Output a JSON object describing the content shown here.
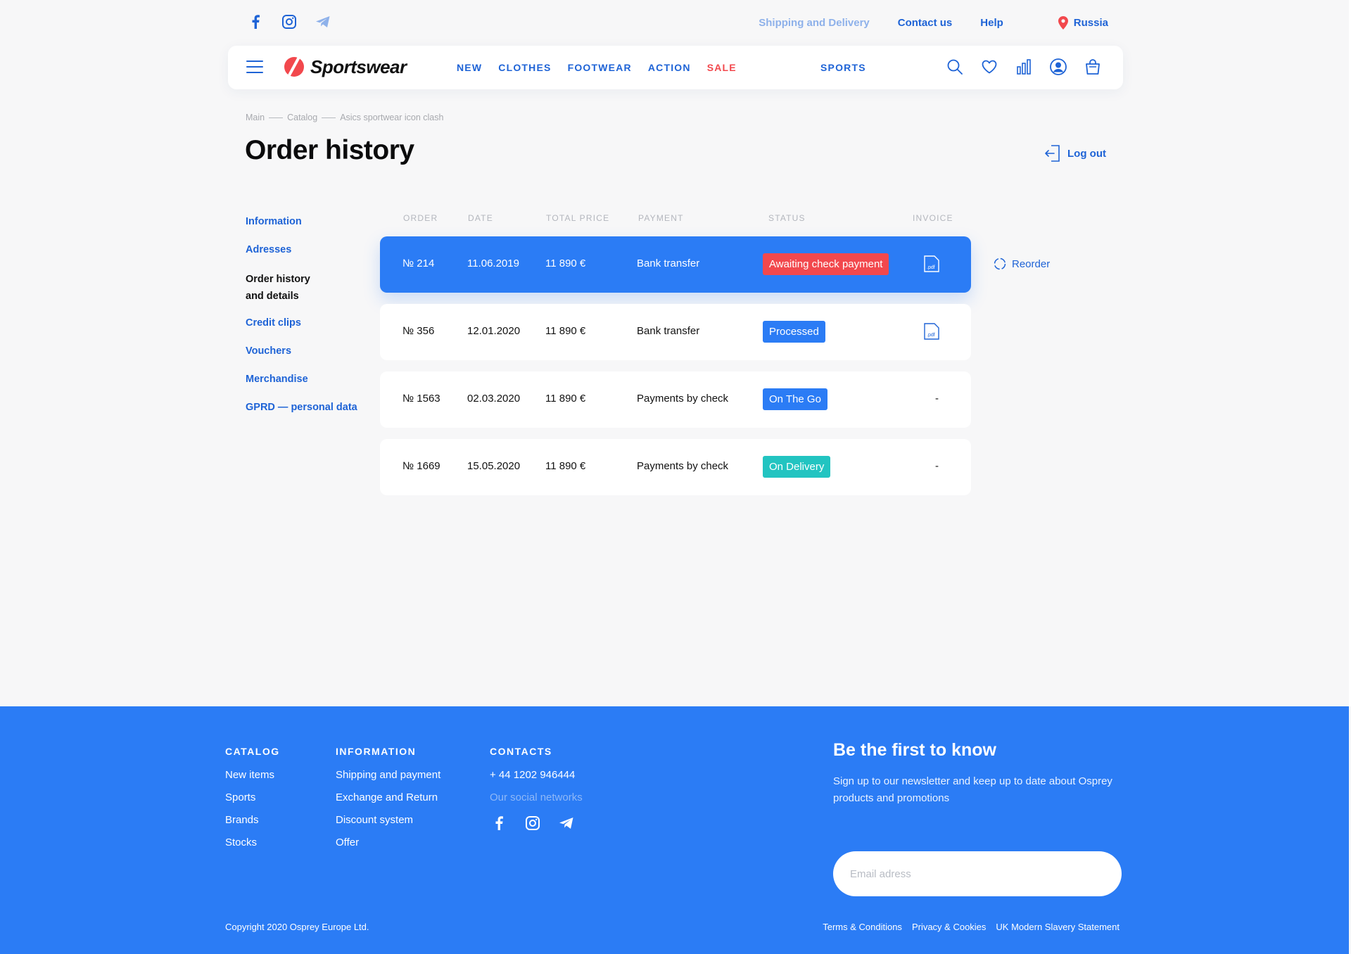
{
  "colors": {
    "accent": "#2b7cf5",
    "link": "#1e63d6",
    "sale": "#f2484d",
    "status_awaiting": "#f2484d",
    "status_processed": "#2b7cf5",
    "status_on_the_go": "#2b7cf5",
    "status_on_delivery": "#22c4c1"
  },
  "topbar": {
    "social_icons": [
      "facebook-icon",
      "instagram-icon",
      "telegram-icon"
    ],
    "links": {
      "shipping": "Shipping and Delivery",
      "contact": "Contact us",
      "help": "Help"
    },
    "region": "Russia"
  },
  "header": {
    "logo_text": "Sportswear",
    "nav": {
      "new": "NEW",
      "clothes": "CLOTHES",
      "footwear": "FOOTWEAR",
      "action": "ACTION",
      "sale": "SALE",
      "sports": "SPORTS"
    },
    "icons": [
      "search-icon",
      "heart-icon",
      "compare-icon",
      "user-icon",
      "cart-icon"
    ]
  },
  "breadcrumb": [
    "Main",
    "Catalog",
    "Asics sportwear icon clash"
  ],
  "page": {
    "title": "Order history",
    "logout": "Log out"
  },
  "sidebar": {
    "items": [
      {
        "label": "Information",
        "active": false
      },
      {
        "label": "Adresses",
        "active": false
      },
      {
        "label": "Order history and details",
        "active": true
      },
      {
        "label": "Credit clips",
        "active": false
      },
      {
        "label": "Vouchers",
        "active": false
      },
      {
        "label": "Merchandise",
        "active": false
      },
      {
        "label": "GPRD — personal data",
        "active": false
      }
    ]
  },
  "table": {
    "headers": {
      "order": "ORDER",
      "date": "DATE",
      "total": "TOTAL PRICE",
      "payment": "PAYMENT",
      "status": "STATUS",
      "invoice": "INVOICE"
    },
    "rows": [
      {
        "order": "№ 214",
        "date": "11.06.2019",
        "total": "11 890 €",
        "payment": "Bank transfer",
        "status": "Awaiting check payment",
        "invoice": ".pdf"
      },
      {
        "order": "№ 356",
        "date": "12.01.2020",
        "total": "11 890 €",
        "payment": "Bank transfer",
        "status": "Processed",
        "invoice": ".pdf"
      },
      {
        "order": "№ 1563",
        "date": "02.03.2020",
        "total": "11 890 €",
        "payment": "Payments by check",
        "status": "On The Go",
        "invoice": "-"
      },
      {
        "order": "№ 1669",
        "date": "15.05.2020",
        "total": "11 890 €",
        "payment": "Payments by check",
        "status": "On Delivery",
        "invoice": "-"
      }
    ],
    "reorder": "Reorder"
  },
  "footer": {
    "catalog": {
      "heading": "CATALOG",
      "items": [
        "New items",
        "Sports",
        "Brands",
        "Stocks"
      ]
    },
    "information": {
      "heading": "INFORMATION",
      "items": [
        "Shipping and payment",
        "Exchange and Return",
        "Discount system",
        "Offer"
      ]
    },
    "contacts": {
      "heading": "CONTACTS",
      "phone": "+ 44 1202 946444",
      "social_label": "Our social networks",
      "social_icons": [
        "facebook-icon",
        "instagram-icon",
        "telegram-icon"
      ]
    },
    "newsletter": {
      "title": "Be the first to know",
      "text": "Sign up to our newsletter and keep up to date about Osprey products and promotions",
      "placeholder": "Email adress"
    },
    "copyright": "Copyright 2020 Osprey Europe Ltd.",
    "legal": [
      "Terms & Conditions",
      "Privacy & Cookies",
      "UK Modern Slavery Statement"
    ]
  }
}
